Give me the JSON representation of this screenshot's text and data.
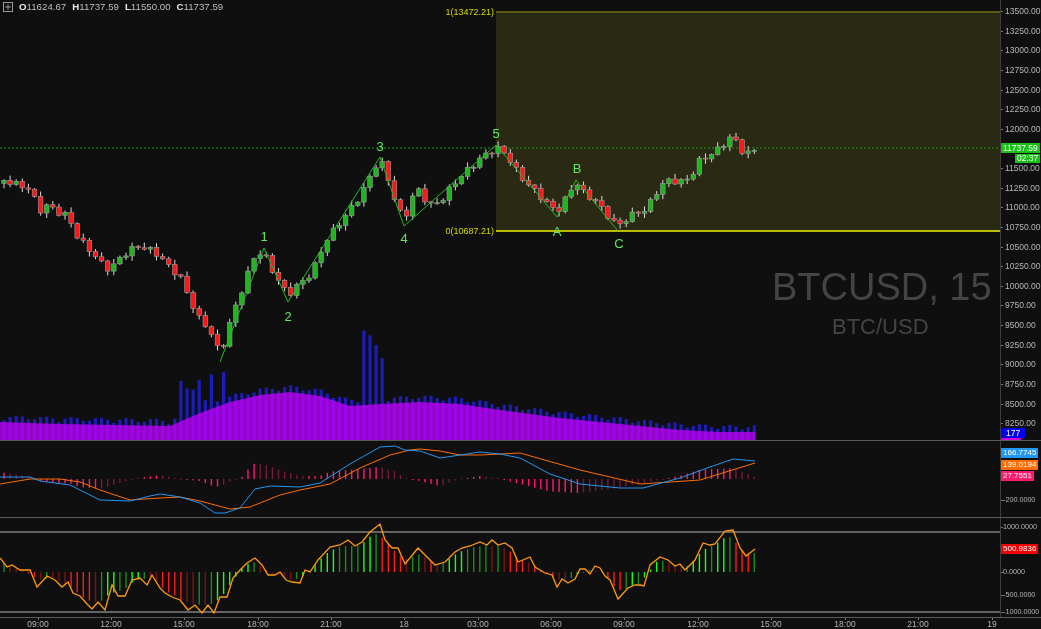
{
  "header": {
    "ohlc": [
      {
        "label": "O",
        "value": "11624.67"
      },
      {
        "label": "H",
        "value": "11737.59"
      },
      {
        "label": "L",
        "value": "11550.00"
      },
      {
        "label": "C",
        "value": "11737.59"
      }
    ]
  },
  "price_chart": {
    "watermark": {
      "symbol": "BTCUSD, 15",
      "pair": "BTC/USD"
    },
    "fibonacci_levels": [
      "1(13472.21)",
      "0(10687.21)"
    ],
    "wave_labels": [
      "1",
      "2",
      "3",
      "4",
      "5",
      "A",
      "B",
      "C"
    ],
    "axis_ticks": [
      "13500.00",
      "13250.00",
      "13000.00",
      "12750.00",
      "12500.00",
      "12250.00",
      "12000.00",
      "11500.00",
      "11250.00",
      "11000.00",
      "10750.00",
      "10500.00",
      "10250.00",
      "10000.00",
      "9750.00",
      "9500.00",
      "9250.00",
      "9000.00",
      "8750.00",
      "8500.00",
      "8250.00"
    ],
    "last_price_tag": "11737.59",
    "countdown_tag": "02:37",
    "volume_tag": "177"
  },
  "macd_panel": {
    "axis_ticks": [
      "-200.0000"
    ],
    "value_tags": [
      {
        "text": "166.7745",
        "color": "#2196f3"
      },
      {
        "text": "139.0194",
        "color": "#ff6d00"
      },
      {
        "text": "27.7551",
        "color": "#ff1a6c"
      }
    ]
  },
  "oscillator_panel": {
    "axis_ticks": [
      "1000.0000",
      "0.0000",
      "-500.0000",
      "-1000.0000"
    ],
    "value_tag": "500.9836"
  },
  "time_axis": {
    "labels": [
      "09:00",
      "12:00",
      "15:00",
      "18:00",
      "21:00",
      "18",
      "03:00",
      "06:00",
      "09:00",
      "12:00",
      "15:00",
      "18:00",
      "21:00",
      "19"
    ]
  }
}
